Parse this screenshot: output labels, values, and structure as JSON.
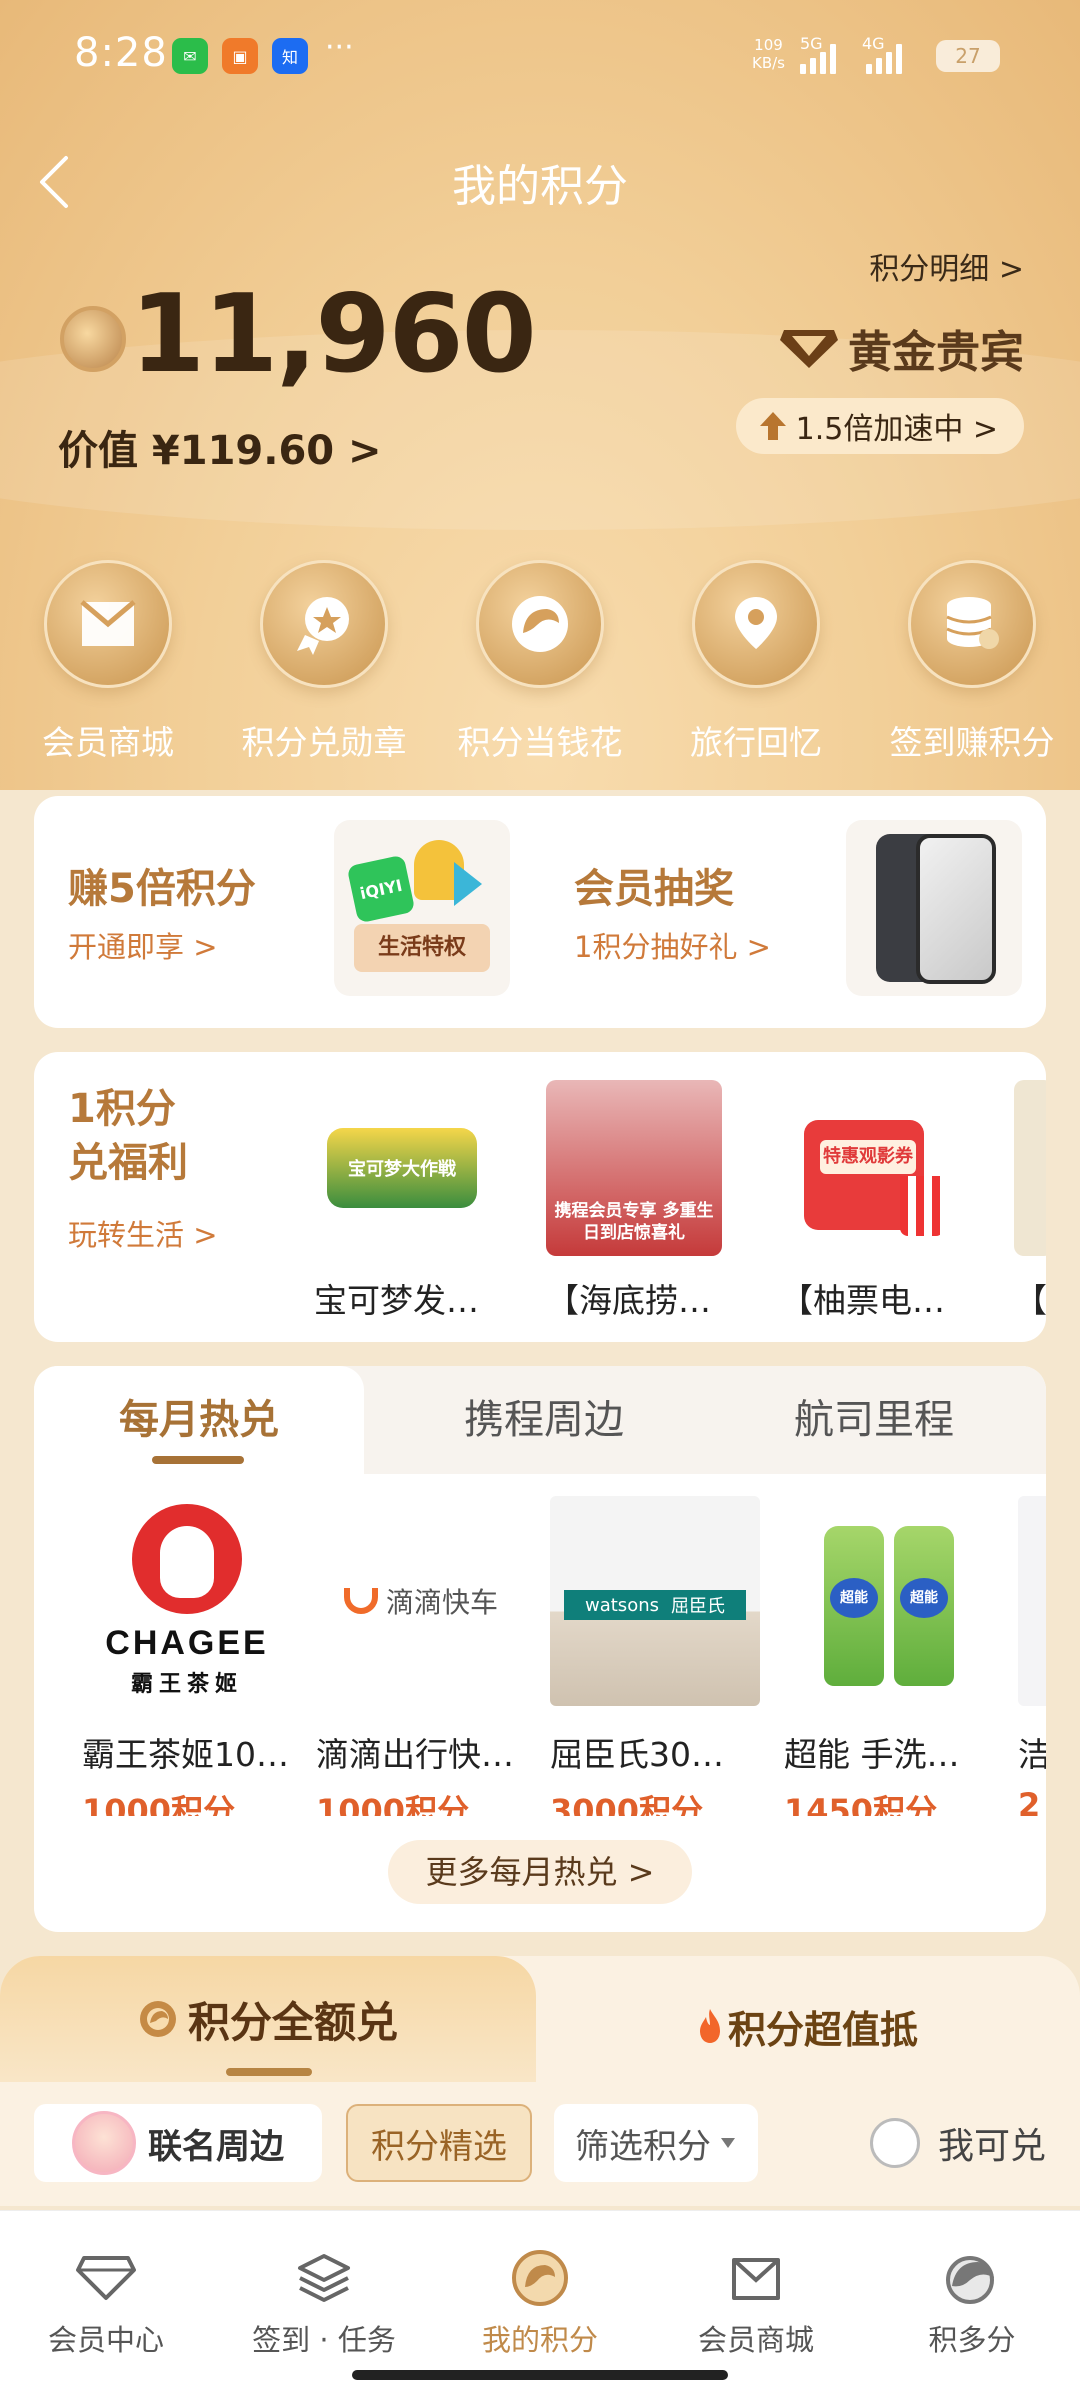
{
  "status": {
    "time": "8:28",
    "speed_value": "109",
    "speed_unit": "KB/s",
    "net1": "5G",
    "net2": "4G",
    "battery": "27"
  },
  "header": {
    "title": "我的积分",
    "detail_link": "积分明细 >",
    "points": "11,960",
    "value_label": "价值 ¥119.60 >",
    "tier": "黄金贵宾",
    "boost": "1.5倍加速中 >"
  },
  "quick_actions": [
    {
      "label": "会员商城",
      "icon": "mall-bag-icon"
    },
    {
      "label": "积分兑勋章",
      "icon": "medal-icon"
    },
    {
      "label": "积分当钱花",
      "icon": "coin-icon"
    },
    {
      "label": "旅行回忆",
      "icon": "map-pin-icon"
    },
    {
      "label": "签到赚积分",
      "icon": "coin-stack-icon"
    }
  ],
  "promo": {
    "left_title": "赚5倍积分",
    "left_sub": "开通即享 >",
    "left_img_text": "生活特权",
    "left_img_brand": "iQIYI",
    "right_title": "会员抽奖",
    "right_sub": "1积分抽好礼 >"
  },
  "welfare": {
    "title_line1": "1积分",
    "title_line2": "兑福利",
    "sub": "玩转生活 >",
    "items": [
      {
        "name": "宝可梦发…",
        "thumb_text": "宝可梦大作戦"
      },
      {
        "name": "【海底捞…",
        "thumb_text": "携程会员专享 多重生日到店惊喜礼"
      },
      {
        "name": "【柚票电…",
        "thumb_text": "特惠观影券"
      },
      {
        "name": "【"
      }
    ]
  },
  "hot_tabs": [
    "每月热兑",
    "携程周边",
    "航司里程"
  ],
  "products": [
    {
      "name": "霸王茶姬10…",
      "points": "1000积分",
      "brand_main": "CHAGEE",
      "brand_sub": "霸王茶姬"
    },
    {
      "name": "滴滴出行快…",
      "points": "1000积分",
      "brand_main": "滴滴快车"
    },
    {
      "name": "屈臣氏30…",
      "points": "3000积分",
      "brand_main": "watsons",
      "brand_sub": "屈臣氏"
    },
    {
      "name": "超能 手洗…",
      "points": "1450积分",
      "brand_main": "超能"
    },
    {
      "name": "洁",
      "points": "2"
    }
  ],
  "more_hot": "更多每月热兑 >",
  "exchange": {
    "tab_full": "积分全额兑",
    "tab_offset": "积分超值抵",
    "chip_ip": "联名周边",
    "chip_selected": "积分精选",
    "chip_filter": "筛选积分",
    "can_exchange": "我可兑"
  },
  "nav": [
    {
      "label": "会员中心",
      "icon": "diamond-icon"
    },
    {
      "label": "签到 · 任务",
      "icon": "layers-icon"
    },
    {
      "label": "我的积分",
      "icon": "points-coin-icon"
    },
    {
      "label": "会员商城",
      "icon": "mall-bag-icon"
    },
    {
      "label": "积多分",
      "icon": "dolphin-icon"
    }
  ],
  "colors": {
    "accent_gold": "#b6793a",
    "points_orange": "#e0602b",
    "header_gold": "#f2cf98"
  }
}
